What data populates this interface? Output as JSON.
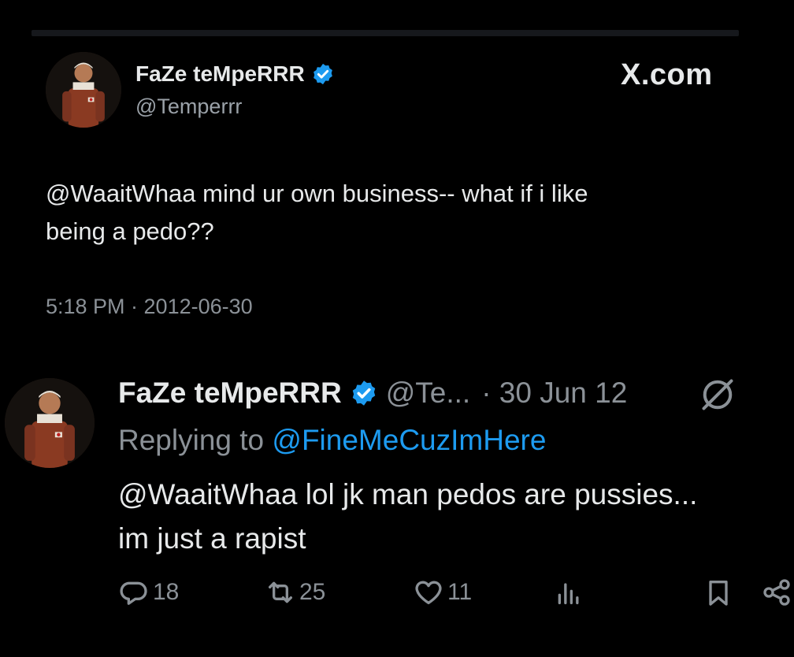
{
  "tweet_main": {
    "display_name": "FaZe teMpeRRR",
    "handle": "@Temperrr",
    "site": "X.com",
    "text_line1": "@WaaitWhaa mind ur own business-- what if i like",
    "text_line2": "being a pedo??",
    "timestamp": "5:18 PM · 2012-06-30",
    "verified_icon": "verified-badge-icon"
  },
  "tweet_reply": {
    "display_name": "FaZe teMpeRRR",
    "handle": "@Te...",
    "date": "· 30 Jun 12",
    "replying_prefix": "Replying to ",
    "replying_to": "@FineMeCuzImHere",
    "text_line1": "@WaaitWhaa lol jk man pedos are pussies...",
    "text_line2": "im just a rapist",
    "grok_icon": "grok-icon"
  },
  "actions": {
    "replies": "18",
    "retweets": "25",
    "likes": "11",
    "views": "",
    "icons": [
      "reply-icon",
      "retweet-icon",
      "like-icon",
      "views-icon",
      "bookmark-icon",
      "share-icon"
    ]
  },
  "colors": {
    "background": "#000000",
    "text": "#e7e9ea",
    "muted": "#8b9197",
    "link": "#1d9bf0",
    "verified": "#1d9bf0"
  }
}
